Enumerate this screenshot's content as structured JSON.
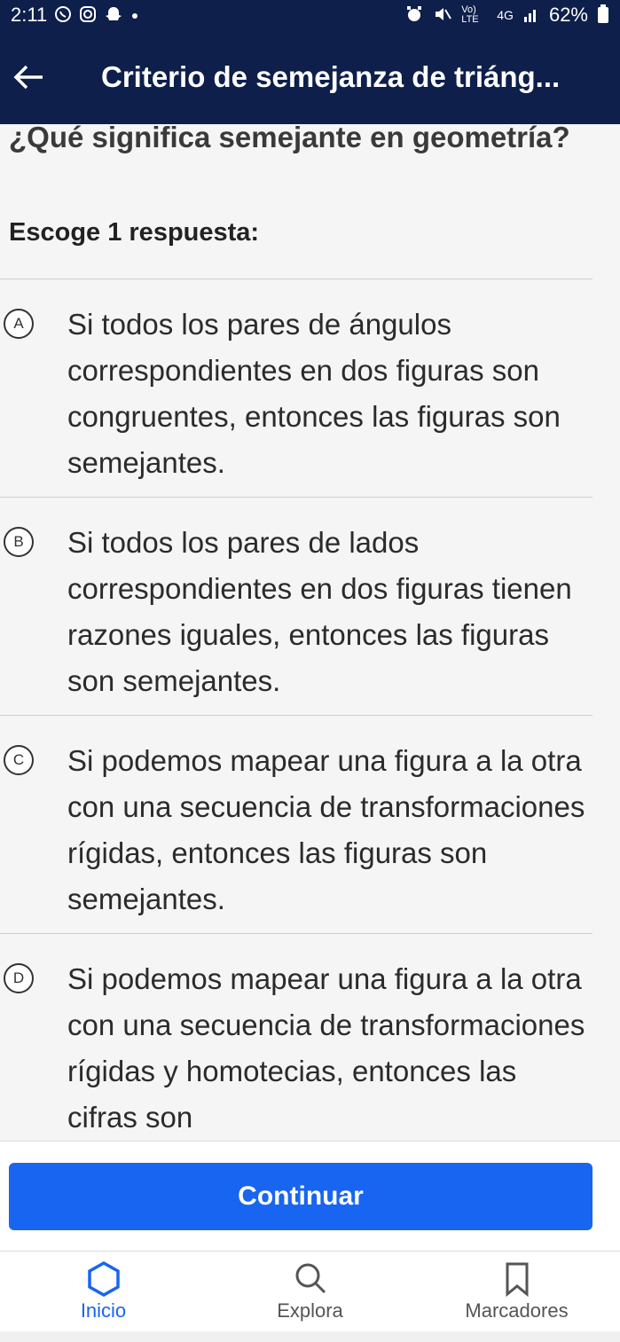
{
  "status_bar": {
    "time": "2:11",
    "battery": "62%",
    "network": "4G",
    "volte": "Vo) LTE"
  },
  "header": {
    "title": "Criterio de semejanza de triáng..."
  },
  "question": {
    "text": "¿Qué significa semejante en geometría?",
    "instruction": "Escoge 1 respuesta:"
  },
  "options": [
    {
      "letter": "A",
      "text": "Si todos los pares de ángulos correspondientes en dos figuras son congruentes, entonces las figuras son semejantes."
    },
    {
      "letter": "B",
      "text": "Si todos los pares de lados correspondientes en dos figuras tienen razones iguales, entonces las figuras son semejantes."
    },
    {
      "letter": "C",
      "text": "Si podemos mapear una figura a la otra con una secuencia de transformaciones rígidas, entonces las figuras son semejantes."
    },
    {
      "letter": "D",
      "text": "Si podemos mapear una figura a la otra con una secuencia de transformaciones rígidas y homotecias, entonces las cifras son"
    }
  ],
  "continue_label": "Continuar",
  "tabs": [
    {
      "label": "Inicio",
      "icon": "hexagon-icon",
      "active": true
    },
    {
      "label": "Explora",
      "icon": "search-icon",
      "active": false
    },
    {
      "label": "Marcadores",
      "icon": "bookmark-icon",
      "active": false
    }
  ],
  "colors": {
    "header_bg": "#0d1f4a",
    "accent": "#1865f2"
  }
}
